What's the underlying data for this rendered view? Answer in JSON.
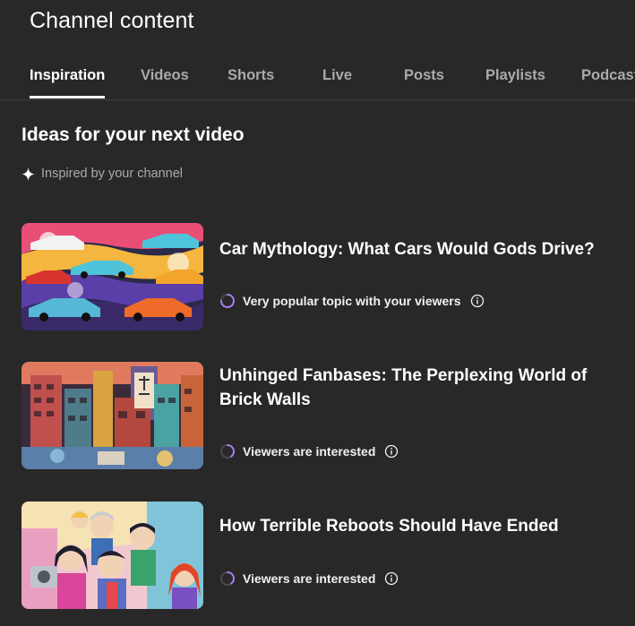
{
  "header": {
    "title": "Channel content"
  },
  "tabs": [
    {
      "label": "Inspiration",
      "active": true
    },
    {
      "label": "Videos",
      "active": false
    },
    {
      "label": "Shorts",
      "active": false
    },
    {
      "label": "Live",
      "active": false
    },
    {
      "label": "Posts",
      "active": false
    },
    {
      "label": "Playlists",
      "active": false
    },
    {
      "label": "Podcasts",
      "active": false
    }
  ],
  "section": {
    "title": "Ideas for your next video",
    "subtitle": "Inspired by your channel",
    "subtitle_icon": "sparkle-icon"
  },
  "ideas": [
    {
      "title": "Car Mythology: What Cars Would Gods Drive?",
      "status": "Very popular topic with your viewers",
      "popularity": 0.75,
      "thumbnail": "sports-cars-illustration"
    },
    {
      "title": "Unhinged Fanbases: The Perplexing World of Brick Walls",
      "status": "Viewers are interested",
      "popularity": 0.4,
      "thumbnail": "brick-city-illustration"
    },
    {
      "title": "How Terrible Reboots Should Have Ended",
      "status": "Viewers are interested",
      "popularity": 0.4,
      "thumbnail": "comic-characters-illustration"
    }
  ],
  "colors": {
    "background": "#282828",
    "text_primary": "#ffffff",
    "text_secondary": "#aaaaaa",
    "accent_purple": "#a87cf0",
    "divider": "#3f3f3f"
  }
}
